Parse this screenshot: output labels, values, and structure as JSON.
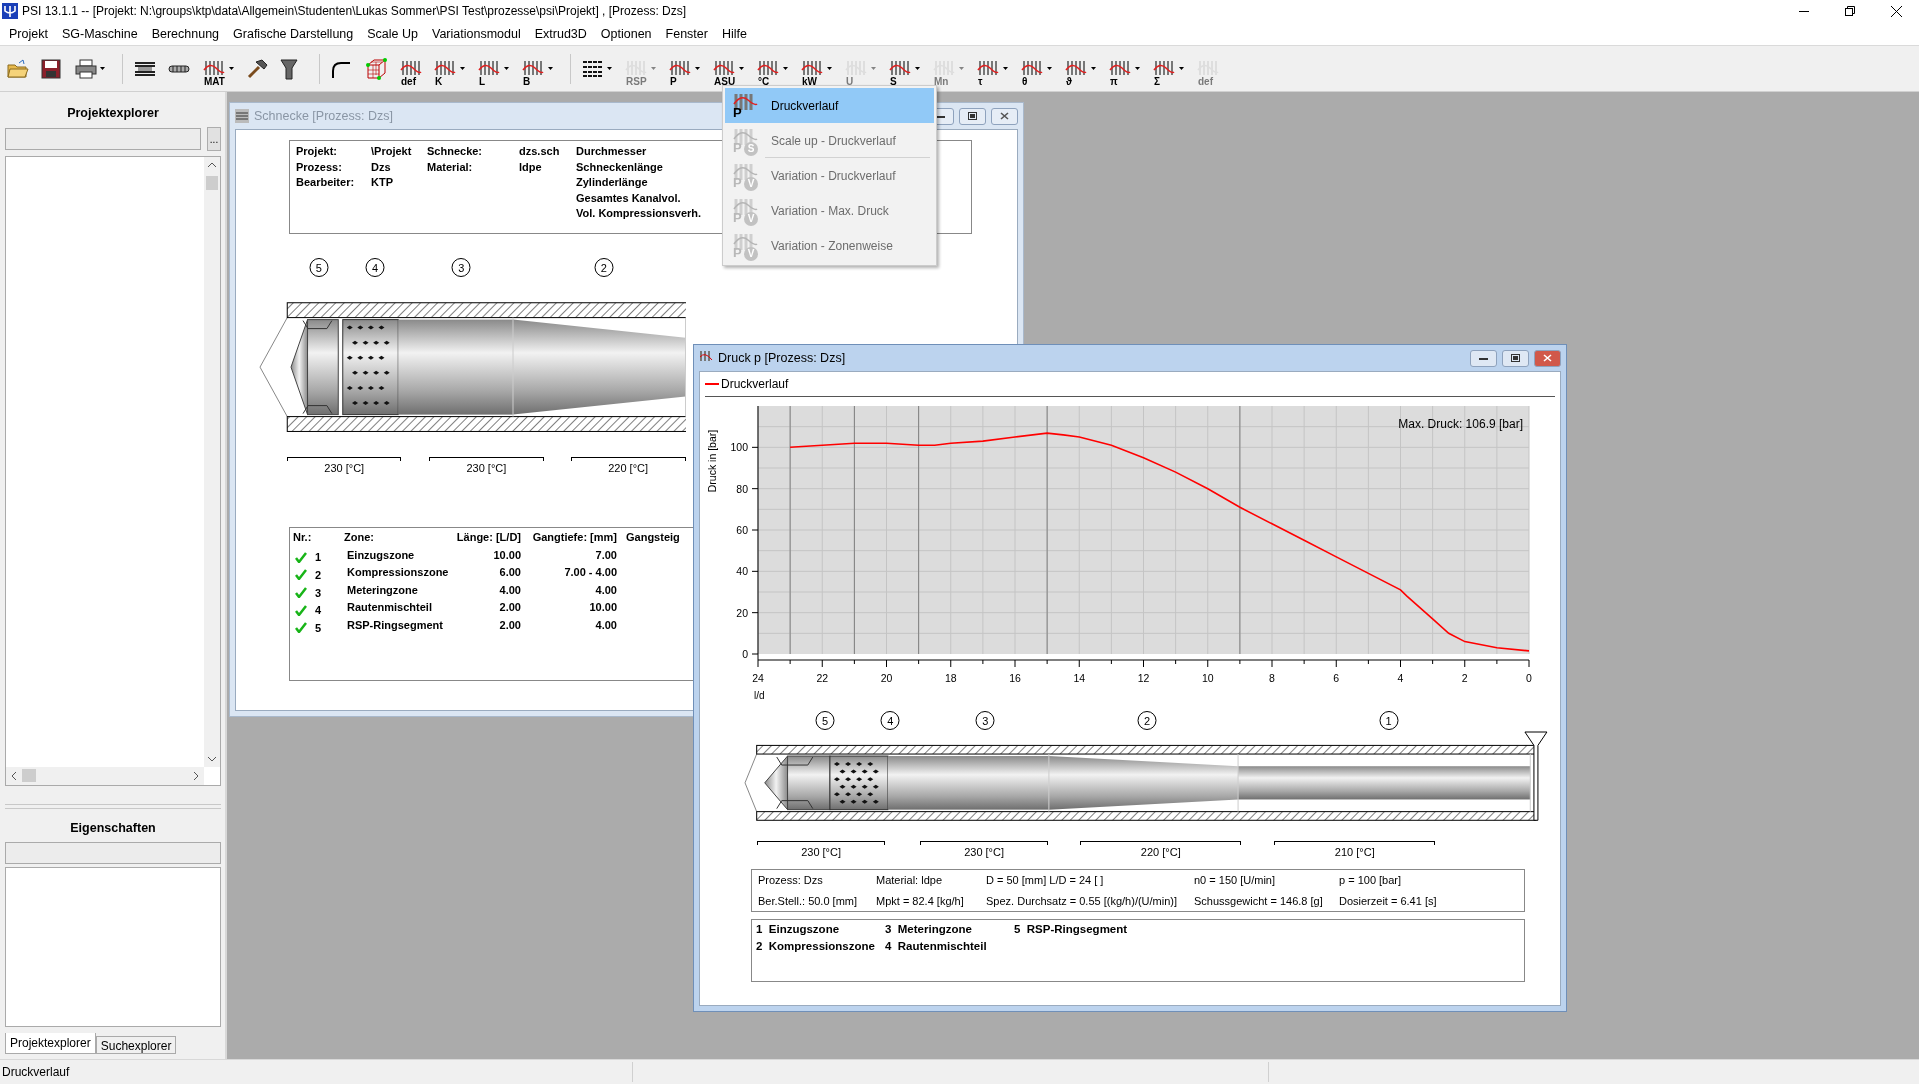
{
  "window": {
    "title": "PSI 13.1.1 -- [Projekt: N:\\groups\\ktp\\data\\Allgemein\\Studenten\\Lukas Sommer\\PSI Test\\prozesse\\psi\\Projekt] , [Prozess: Dzs]"
  },
  "menu": [
    "Projekt",
    "SG-Maschine",
    "Berechnung",
    "Grafische Darstellung",
    "Scale Up",
    "Variationsmodul",
    "Extrud3D",
    "Optionen",
    "Fenster",
    "Hilfe"
  ],
  "toolbar": [
    {
      "kind": "folder",
      "disabled": false,
      "dropdown": false
    },
    {
      "kind": "floppy",
      "disabled": false,
      "dropdown": false
    },
    {
      "kind": "printer",
      "disabled": false,
      "dropdown": true
    },
    {
      "kind": "separator"
    },
    {
      "kind": "barrel",
      "disabled": false,
      "dropdown": false
    },
    {
      "kind": "screw",
      "disabled": false,
      "dropdown": false
    },
    {
      "kind": "chart",
      "label": "MAT",
      "disabled": false,
      "dropdown": true
    },
    {
      "kind": "hammer",
      "disabled": false,
      "dropdown": false
    },
    {
      "kind": "funnel",
      "disabled": false,
      "dropdown": false
    },
    {
      "kind": "separator"
    },
    {
      "kind": "curve",
      "disabled": false,
      "dropdown": false
    },
    {
      "kind": "cube",
      "disabled": false,
      "dropdown": false
    },
    {
      "kind": "chart",
      "label": "def",
      "disabled": false,
      "dropdown": false
    },
    {
      "kind": "chart",
      "label": "K",
      "disabled": false,
      "dropdown": true
    },
    {
      "kind": "chart",
      "label": "L",
      "disabled": false,
      "dropdown": true
    },
    {
      "kind": "chart",
      "label": "B",
      "disabled": false,
      "dropdown": true
    },
    {
      "kind": "separator"
    },
    {
      "kind": "lines",
      "disabled": false,
      "dropdown": true
    },
    {
      "kind": "chart",
      "label": "RSP",
      "disabled": true,
      "dropdown": true
    },
    {
      "kind": "chart",
      "label": "P",
      "disabled": false,
      "dropdown": true
    },
    {
      "kind": "chart",
      "label": "ASU",
      "disabled": false,
      "dropdown": true
    },
    {
      "kind": "chart",
      "label": "°C",
      "disabled": false,
      "dropdown": true
    },
    {
      "kind": "chart",
      "label": "kW",
      "disabled": false,
      "dropdown": true
    },
    {
      "kind": "chart",
      "label": "U",
      "disabled": true,
      "dropdown": true
    },
    {
      "kind": "chart",
      "label": "S",
      "disabled": false,
      "dropdown": true
    },
    {
      "kind": "chart",
      "label": "Mn",
      "disabled": true,
      "dropdown": true
    },
    {
      "kind": "chart",
      "label": "τ",
      "disabled": false,
      "dropdown": true
    },
    {
      "kind": "chart",
      "label": "θ",
      "disabled": false,
      "dropdown": true
    },
    {
      "kind": "chart",
      "label": "ϑ",
      "disabled": false,
      "dropdown": true
    },
    {
      "kind": "chart",
      "label": "π",
      "disabled": false,
      "dropdown": true
    },
    {
      "kind": "chart",
      "label": "Σ",
      "disabled": false,
      "dropdown": true
    },
    {
      "kind": "chart",
      "label": "def",
      "disabled": true,
      "dropdown": false
    }
  ],
  "sidebar": {
    "title": "Projektexplorer",
    "browse_button": "...",
    "properties_title": "Eigenschaften",
    "tabs": [
      {
        "label": "Projektexplorer",
        "selected": true
      },
      {
        "label": "Suchexplorer",
        "selected": false
      }
    ]
  },
  "dropdown_menu": [
    {
      "label": "Druckverlauf",
      "icon_letter": "P",
      "selected": true,
      "disabled": false,
      "separator_after": false
    },
    {
      "label": "Scale up - Druckverlauf",
      "icon_letter": "P",
      "icon_sub": "S",
      "selected": false,
      "disabled": true,
      "separator_after": true
    },
    {
      "label": "Variation - Druckverlauf",
      "icon_letter": "P",
      "icon_sub": "V",
      "selected": false,
      "disabled": true,
      "separator_after": false
    },
    {
      "label": "Variation - Max. Druck",
      "icon_letter": "P",
      "icon_sub": "V",
      "selected": false,
      "disabled": true,
      "separator_after": false
    },
    {
      "label": "Variation - Zonenweise",
      "icon_letter": "P",
      "icon_sub": "V",
      "selected": false,
      "disabled": true,
      "separator_after": false
    }
  ],
  "screw_window": {
    "title": "Schnecke [Prozess: Dzs]",
    "active": false,
    "info_columns": [
      [
        "Projekt:",
        "Prozess:",
        "Bearbeiter:"
      ],
      [
        "\\Projekt",
        "Dzs",
        "KTP"
      ],
      [
        "Schnecke:",
        "Material:"
      ],
      [
        "dzs.sch",
        "ldpe"
      ],
      [
        "Durchmesser",
        "Schneckenlänge",
        "Zylinderlänge",
        "Gesamtes Kanalvol.",
        "Vol. Kompressionsverh."
      ]
    ],
    "zone_markers": [
      "5",
      "4",
      "3",
      "2"
    ],
    "temperatures": [
      "230 [°C]",
      "230 [°C]",
      "220 [°C]"
    ],
    "zone_table": {
      "columns": [
        "Nr.:",
        "Zone:",
        "Länge: [L/D]",
        "Gangtiefe: [mm]",
        "Gangsteig"
      ],
      "rows": [
        {
          "ok": true,
          "cells": [
            "1",
            "Einzugszone",
            "10.00",
            "7.00"
          ]
        },
        {
          "ok": true,
          "cells": [
            "2",
            "Kompressionszone",
            "6.00",
            "7.00 - 4.00"
          ]
        },
        {
          "ok": true,
          "cells": [
            "3",
            "Meteringzone",
            "4.00",
            "4.00"
          ]
        },
        {
          "ok": true,
          "cells": [
            "4",
            "Rautenmischteil",
            "2.00",
            "10.00"
          ]
        },
        {
          "ok": true,
          "cells": [
            "5",
            "RSP-Ringsegment",
            "2.00",
            "4.00"
          ]
        }
      ]
    }
  },
  "pressure_window": {
    "title": "Druck p [Prozess: Dzs]",
    "active": true,
    "chart_data": {
      "type": "line",
      "grid": true,
      "xlabel": "l/d",
      "ylabel": "Druck in [bar]",
      "xlim": [
        24,
        0
      ],
      "ylim": [
        0,
        120
      ],
      "xticks": [
        24,
        22,
        20,
        18,
        16,
        14,
        12,
        10,
        8,
        6,
        4,
        2,
        0
      ],
      "yticks": [
        0,
        20,
        40,
        60,
        80,
        100
      ],
      "series": [
        {
          "name": "Druckverlauf",
          "color": "#ff0000",
          "x": [
            23,
            22,
            21,
            20,
            19,
            18.5,
            18,
            17,
            16,
            15,
            14.5,
            14,
            13,
            12,
            11,
            10,
            9,
            8,
            7,
            6,
            5,
            4,
            3.8,
            3,
            2.5,
            2,
            1,
            0
          ],
          "values": [
            100,
            101,
            102,
            102,
            101,
            101,
            102,
            103,
            105,
            106.9,
            106,
            105,
            101,
            95,
            88,
            80,
            71,
            63,
            55,
            47,
            39,
            31,
            28,
            17,
            10,
            6,
            3,
            1.5
          ]
        }
      ],
      "annotations": [
        {
          "text": "Max. Druck: 106.9 [bar]"
        }
      ]
    },
    "zone_markers": [
      "5",
      "4",
      "3",
      "2",
      "1"
    ],
    "temperatures": [
      "230 [°C]",
      "230 [°C]",
      "220 [°C]",
      "210 [°C]"
    ],
    "process_info": [
      [
        "Prozess: Dzs",
        "Material: ldpe",
        "D = 50 [mm]  L/D = 24 [ ]",
        "n0 = 150 [U/min]",
        "p = 100 [bar]"
      ],
      [
        "Ber.Stell.:  50.0 [mm]",
        "Mpkt = 82.4 [kg/h]",
        "Spez. Durchsatz = 0.55 [(kg/h)/(U/min)]",
        "Schussgewicht = 146.8 [g]",
        "Dosierzeit = 6.41 [s]"
      ]
    ],
    "zone_legend": [
      {
        "number": "1",
        "name": "Einzugszone"
      },
      {
        "number": "2",
        "name": "Kompressionszone"
      },
      {
        "number": "3",
        "name": "Meteringzone"
      },
      {
        "number": "4",
        "name": "Rautenmischteil"
      },
      {
        "number": "5",
        "name": "RSP-Ringsegment"
      }
    ]
  },
  "status_bar": "Druckverlauf"
}
